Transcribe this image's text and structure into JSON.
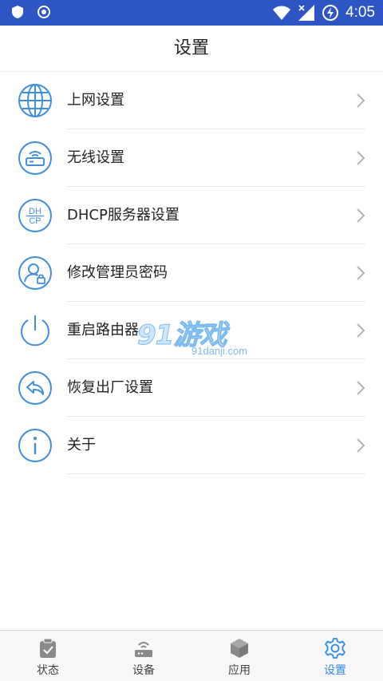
{
  "status_bar": {
    "time": "4:05",
    "icons": [
      "shield-icon",
      "record-icon",
      "wifi-icon",
      "no-signal-icon",
      "battery-charging-icon"
    ]
  },
  "header": {
    "title": "设置"
  },
  "settings": {
    "items": [
      {
        "label": "上网设置",
        "icon": "globe-icon"
      },
      {
        "label": "无线设置",
        "icon": "router-wifi-icon"
      },
      {
        "label": "DHCP服务器设置",
        "icon": "dhcp-icon",
        "icon_text_top": "DH",
        "icon_text_bottom": "CP"
      },
      {
        "label": "修改管理员密码",
        "icon": "user-lock-icon"
      },
      {
        "label": "重启路由器",
        "icon": "power-icon"
      },
      {
        "label": "恢复出厂设置",
        "icon": "reply-icon"
      },
      {
        "label": "关于",
        "icon": "info-icon"
      }
    ]
  },
  "watermark": {
    "main": "91游戏",
    "sub": "91danji.com"
  },
  "tabbar": {
    "tabs": [
      {
        "label": "状态",
        "icon": "status-clipboard-icon",
        "active": false
      },
      {
        "label": "设备",
        "icon": "device-router-icon",
        "active": false
      },
      {
        "label": "应用",
        "icon": "app-box-icon",
        "active": false
      },
      {
        "label": "设置",
        "icon": "gear-icon",
        "active": true
      }
    ]
  },
  "colors": {
    "status_bar": "#2d56c4",
    "icon_blue": "#3f8fe0",
    "active_tab": "#2d8ae8"
  }
}
